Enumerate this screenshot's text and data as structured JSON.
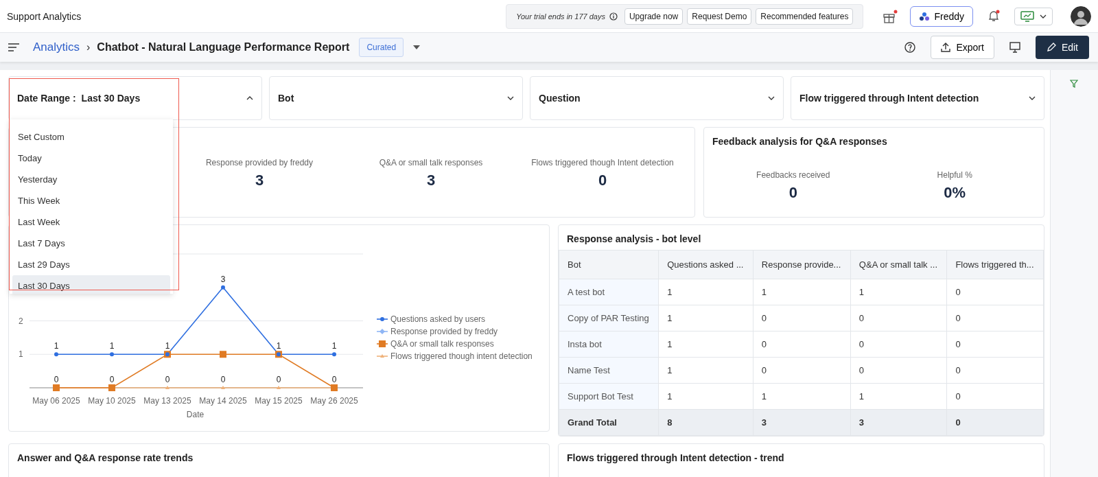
{
  "app": {
    "title": "Support Analytics",
    "trial_notice": "Your trial ends in 177 days",
    "top_buttons": [
      "Upgrade now",
      "Request Demo",
      "Recommended features"
    ],
    "freddy": "Freddy"
  },
  "header": {
    "breadcrumb": "Analytics",
    "separator": "›",
    "title": "Chatbot - Natural Language Performance Report",
    "tag": "Curated",
    "actions": {
      "export": "Export",
      "edit": "Edit"
    }
  },
  "filters": [
    {
      "label": "Date Range :",
      "value": "Last 30 Days",
      "expanded": true
    },
    {
      "label": "Bot",
      "expanded": false
    },
    {
      "label": "Question",
      "expanded": false
    },
    {
      "label": "Flow triggered through Intent detection",
      "expanded": false
    }
  ],
  "date_menu": {
    "items": [
      {
        "label": "Set Custom",
        "selected": false
      },
      {
        "label": "Today",
        "selected": false
      },
      {
        "label": "Yesterday",
        "selected": false
      },
      {
        "label": "This Week",
        "selected": false
      },
      {
        "label": "Last Week",
        "selected": false
      },
      {
        "label": "Last 7 Days",
        "selected": false
      },
      {
        "label": "Last 29 Days",
        "selected": false
      },
      {
        "label": "Last 30 Days",
        "selected": true
      }
    ]
  },
  "stats": [
    {
      "label": "Response provided by freddy",
      "value": "3"
    },
    {
      "label": "Q&A or small talk responses",
      "value": "3"
    },
    {
      "label": "Flows triggered though Intent detection",
      "value": "0"
    }
  ],
  "feedback": {
    "title": "Feedback analysis for Q&A responses",
    "stats": [
      {
        "label": "Feedbacks received",
        "value": "0"
      },
      {
        "label": "Helpful %",
        "value": "0%"
      }
    ]
  },
  "trend_chart": {
    "chart_data": {
      "type": "line",
      "xlabel": "Date",
      "categories": [
        "May 06 2025",
        "May 10 2025",
        "May 13 2025",
        "May 14 2025",
        "May 15 2025",
        "May 26 2025"
      ],
      "ylim": [
        0,
        4
      ],
      "yticks": [
        1,
        2
      ],
      "legend": "right",
      "series": [
        {
          "name": "Questions asked by users",
          "color": "#2f6fe0",
          "marker": "circle",
          "values": [
            1,
            1,
            1,
            3,
            1,
            1
          ],
          "value_labels": [
            "1",
            "1",
            "1",
            "3",
            "1",
            "1"
          ]
        },
        {
          "name": "Response provided by freddy",
          "color": "#8fb6f5",
          "marker": "diamond",
          "values": [
            null,
            null,
            null,
            null,
            null,
            null
          ]
        },
        {
          "name": "Q&A or small talk responses",
          "color": "#e07b24",
          "marker": "square",
          "values": [
            0,
            0,
            1,
            1,
            1,
            0
          ]
        },
        {
          "name": "Flows triggered though intent detection",
          "color": "#efb27a",
          "marker": "triangle",
          "values": [
            0,
            0,
            0,
            0,
            0,
            0
          ],
          "value_labels": [
            "0",
            "0",
            "0",
            "0",
            "0",
            "0"
          ]
        }
      ]
    }
  },
  "bot_table": {
    "title": "Response analysis - bot level",
    "columns": [
      "Bot",
      "Questions asked ...",
      "Response provide...",
      "Q&A or small talk ...",
      "Flows triggered th..."
    ],
    "rows": [
      [
        "A test bot",
        "1",
        "1",
        "1",
        "0"
      ],
      [
        "Copy of PAR Testing",
        "1",
        "0",
        "0",
        "0"
      ],
      [
        "Insta bot",
        "1",
        "0",
        "0",
        "0"
      ],
      [
        "Name Test",
        "1",
        "0",
        "0",
        "0"
      ],
      [
        "Support Bot Test",
        "1",
        "1",
        "1",
        "0"
      ]
    ],
    "total": [
      "Grand Total",
      "8",
      "3",
      "3",
      "0"
    ]
  },
  "bottom_cards": [
    "Answer and Q&A response rate trends",
    "Flows triggered through Intent detection - trend"
  ]
}
